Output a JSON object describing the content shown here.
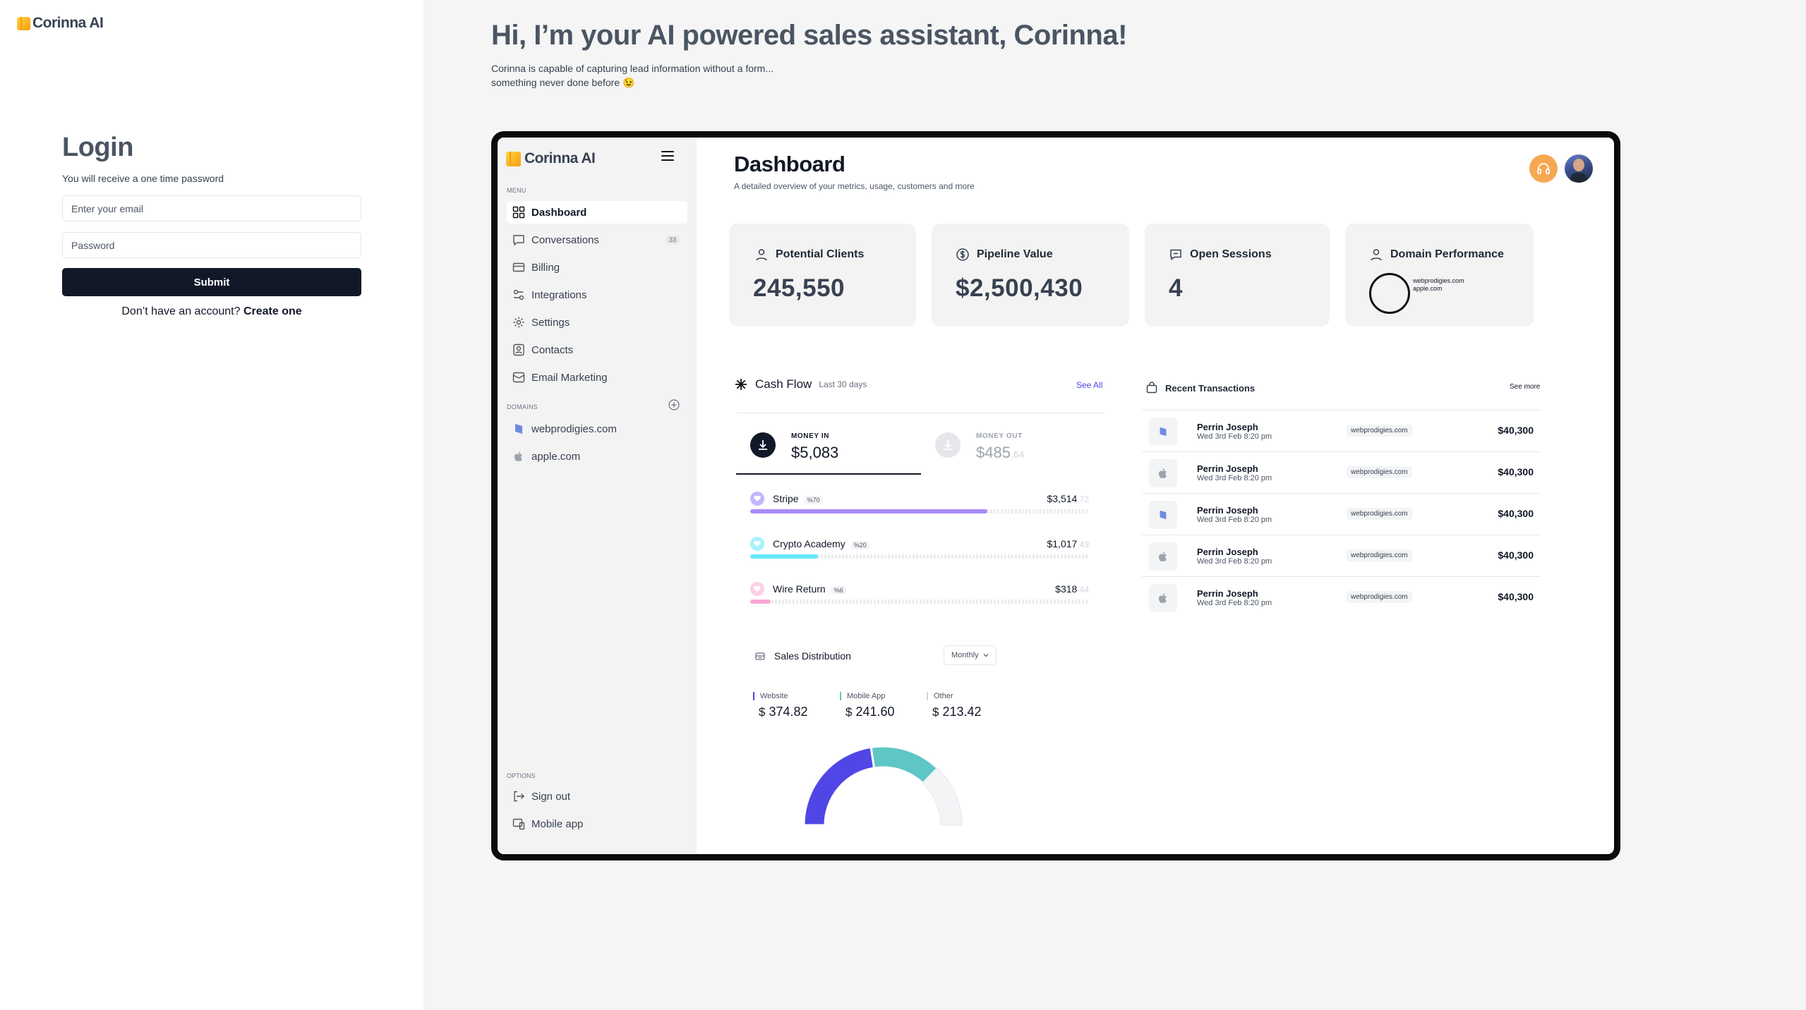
{
  "brand": {
    "name": "Corinna AI",
    "color": "#f59e0b"
  },
  "login": {
    "title": "Login",
    "subtitle": "You will receive a one time password",
    "email_placeholder": "Enter your email",
    "password_placeholder": "Password",
    "submit_label": "Submit",
    "signup_prompt": "Don’t have an account?",
    "signup_link": "Create one"
  },
  "hero": {
    "title": "Hi, I’m your AI powered sales assistant, Corinna!",
    "subtitle_line1": "Corinna is capable of capturing lead information without a form...",
    "subtitle_line2": "something never done before 😉"
  },
  "preview": {
    "sidebar": {
      "menu_label": "MENU",
      "items": [
        {
          "label": "Dashboard",
          "icon": "grid-icon",
          "active": true
        },
        {
          "label": "Conversations",
          "icon": "chat-icon",
          "badge": "33"
        },
        {
          "label": "Billing",
          "icon": "card-icon"
        },
        {
          "label": "Integrations",
          "icon": "integrations-icon"
        },
        {
          "label": "Settings",
          "icon": "gear-icon"
        },
        {
          "label": "Contacts",
          "icon": "contact-icon"
        },
        {
          "label": "Email Marketing",
          "icon": "mail-icon"
        }
      ],
      "domains_label": "DOMAINS",
      "domains": [
        {
          "label": "webprodigies.com",
          "icon": "webprodigies-logo-icon"
        },
        {
          "label": "apple.com",
          "icon": "apple-logo-icon"
        }
      ],
      "options_label": "OPTIONS",
      "options": [
        {
          "label": "Sign out",
          "icon": "signout-icon"
        },
        {
          "label": "Mobile app",
          "icon": "mobile-icon"
        }
      ]
    },
    "header": {
      "title": "Dashboard",
      "subtitle": "A detailed overview of your metrics, usage, customers and more"
    },
    "stats": [
      {
        "label": "Potential Clients",
        "value": "245,550",
        "icon": "user-icon"
      },
      {
        "label": "Pipeline Value",
        "value": "$2,500,430",
        "icon": "dollar-icon"
      },
      {
        "label": "Open Sessions",
        "value": "4",
        "icon": "chat-icon"
      },
      {
        "label": "Domain Performance",
        "icon": "user-icon",
        "domains": [
          "webprodigies.com",
          "apple.com"
        ]
      }
    ],
    "cashflow": {
      "title": "Cash Flow",
      "period": "Last 30 days",
      "see_all": "See All",
      "money_in_label": "MONEY IN",
      "money_in_value": "$5,083",
      "money_out_label": "MONEY OUT",
      "money_out_value": "$485",
      "money_out_cents": ".64",
      "sources": [
        {
          "name": "Stripe",
          "pct": "%70",
          "amount": "$3,514",
          "cents": ".72",
          "color": "#a78bfa",
          "share": 0.7
        },
        {
          "name": "Crypto Academy",
          "pct": "%20",
          "amount": "$1,017",
          "cents": ".49",
          "color": "#67e8f9",
          "share": 0.2
        },
        {
          "name": "Wire Return",
          "pct": "%6",
          "amount": "$318",
          "cents": ".44",
          "color": "#f9a8d4",
          "share": 0.06
        }
      ]
    },
    "transactions": {
      "title": "Recent Transactions",
      "see_more": "See more",
      "rows": [
        {
          "name": "Perrin Joseph",
          "date": "Wed 3rd Feb 8:20 pm",
          "domain": "webprodigies.com",
          "amount": "$40,300",
          "icon": "webprodigies-logo-icon"
        },
        {
          "name": "Perrin Joseph",
          "date": "Wed 3rd Feb 8:20 pm",
          "domain": "webprodigies.com",
          "amount": "$40,300",
          "icon": "apple-logo-icon"
        },
        {
          "name": "Perrin Joseph",
          "date": "Wed 3rd Feb 8:20 pm",
          "domain": "webprodigies.com",
          "amount": "$40,300",
          "icon": "webprodigies-logo-icon"
        },
        {
          "name": "Perrin Joseph",
          "date": "Wed 3rd Feb 8:20 pm",
          "domain": "webprodigies.com",
          "amount": "$40,300",
          "icon": "apple-logo-icon"
        },
        {
          "name": "Perrin Joseph",
          "date": "Wed 3rd Feb 8:20 pm",
          "domain": "webprodigies.com",
          "amount": "$40,300",
          "icon": "apple-logo-icon"
        }
      ]
    },
    "sales_distribution": {
      "title": "Sales Distribution",
      "period": "Monthly",
      "channels": [
        {
          "label": "Website",
          "currency": "$",
          "value": "374.82",
          "color": "#4f46e5"
        },
        {
          "label": "Mobile App",
          "currency": "$",
          "value": "241.60",
          "color": "#5fc6c6"
        },
        {
          "label": "Other",
          "currency": "$",
          "value": "213.42",
          "color": "#e5e7eb"
        }
      ]
    }
  }
}
